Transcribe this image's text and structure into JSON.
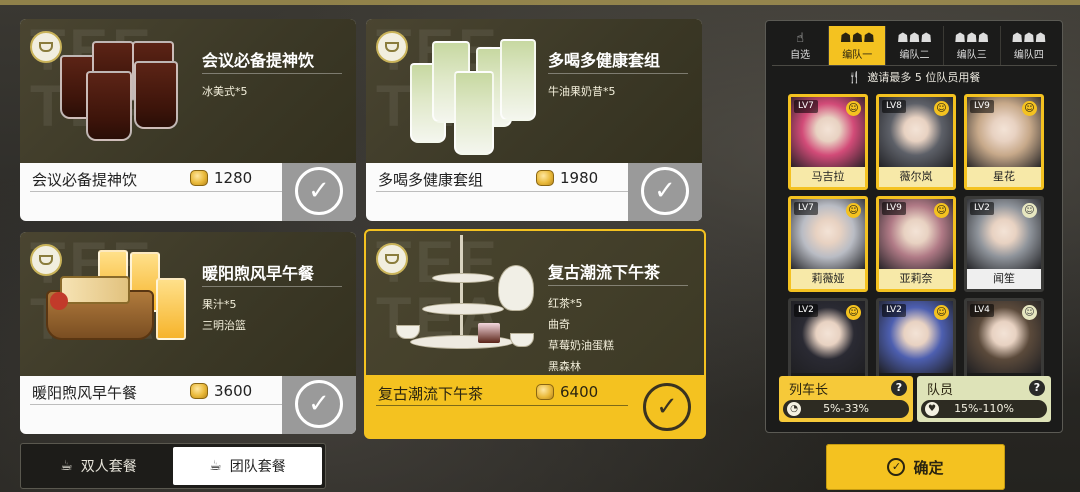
{
  "meals": [
    {
      "title": "会议必备提神饮",
      "items": [
        "冰美式*5"
      ],
      "name": "会议必备提神饮",
      "price": "1280",
      "selected": false
    },
    {
      "title": "多喝多健康套组",
      "items": [
        "牛油果奶昔*5"
      ],
      "name": "多喝多健康套组",
      "price": "1980",
      "selected": false
    },
    {
      "title": "暖阳煦风早午餐",
      "items": [
        "果汁*5",
        "三明治篮"
      ],
      "name": "暖阳煦风早午餐",
      "price": "3600",
      "selected": false
    },
    {
      "title": "复古潮流下午茶",
      "items": [
        "红茶*5",
        "曲奇",
        "草莓奶油蛋糕",
        "黑森林"
      ],
      "name": "复古潮流下午茶",
      "price": "6400",
      "selected": true
    }
  ],
  "set_tabs": {
    "pair": "双人套餐",
    "team": "团队套餐",
    "active": "team"
  },
  "team_tabs": [
    {
      "label": "自选",
      "active": false
    },
    {
      "label": "编队一",
      "active": true
    },
    {
      "label": "编队二",
      "active": false
    },
    {
      "label": "编队三",
      "active": false
    },
    {
      "label": "编队四",
      "active": false
    }
  ],
  "invite_text": "邀请最多 5 位队员用餐",
  "members": [
    {
      "level": "LV7",
      "name": "马吉拉",
      "selected": true,
      "mood": "happy",
      "color": "#d24b78"
    },
    {
      "level": "LV8",
      "name": "薇尔岚",
      "selected": true,
      "mood": "happy",
      "color": "#5d6068"
    },
    {
      "level": "LV9",
      "name": "星花",
      "selected": true,
      "mood": "happy",
      "color": "#c7a98a"
    },
    {
      "level": "LV7",
      "name": "莉薇娅",
      "selected": true,
      "mood": "happy",
      "color": "#b9bcc4"
    },
    {
      "level": "LV9",
      "name": "亚莉奈",
      "selected": true,
      "mood": "happy",
      "color": "#b07a86"
    },
    {
      "level": "LV2",
      "name": "闻笙",
      "selected": false,
      "mood": "neutral",
      "color": "#8f949b"
    },
    {
      "level": "LV2",
      "name": "",
      "selected": false,
      "mood": "happy",
      "color": "#2a2a33"
    },
    {
      "level": "LV2",
      "name": "",
      "selected": false,
      "mood": "happy",
      "color": "#4d5fb0"
    },
    {
      "level": "LV4",
      "name": "",
      "selected": false,
      "mood": "neutral",
      "color": "#5b4a3b"
    }
  ],
  "roles": {
    "leader": {
      "label": "列车长",
      "range": "5%-33%"
    },
    "crew": {
      "label": "队员",
      "range": "15%-110%"
    }
  },
  "confirm_label": "确定"
}
